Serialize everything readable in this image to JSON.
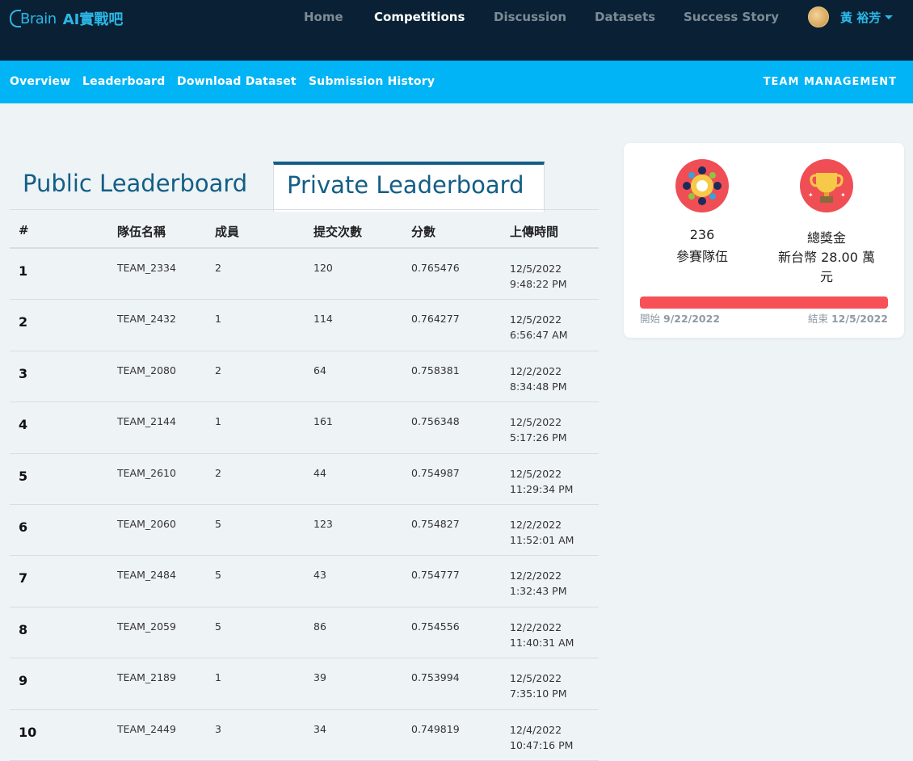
{
  "header": {
    "logo_text": "Brain",
    "logo_ai": "AI實戰吧",
    "nav": [
      {
        "label": "Home"
      },
      {
        "label": "Competitions"
      },
      {
        "label": "Discussion"
      },
      {
        "label": "Datasets"
      },
      {
        "label": "Success Story"
      }
    ],
    "user_name": "黃 裕芳"
  },
  "subnav": {
    "items": [
      {
        "label": "Overview"
      },
      {
        "label": "Leaderboard"
      },
      {
        "label": "Download Dataset"
      },
      {
        "label": "Submission History"
      }
    ],
    "team_management": "TEAM MANAGEMENT"
  },
  "tabs": {
    "public": "Public Leaderboard",
    "private": "Private Leaderboard"
  },
  "table": {
    "headers": [
      "#",
      "隊伍名稱",
      "成員",
      "提交次數",
      "分數",
      "上傳時間"
    ],
    "rows": [
      {
        "rank": "1",
        "team": "TEAM_2334",
        "members": "2",
        "submissions": "120",
        "score": "0.765476",
        "date": "12/5/2022",
        "time": "9:48:22 PM"
      },
      {
        "rank": "2",
        "team": "TEAM_2432",
        "members": "1",
        "submissions": "114",
        "score": "0.764277",
        "date": "12/5/2022",
        "time": "6:56:47 AM"
      },
      {
        "rank": "3",
        "team": "TEAM_2080",
        "members": "2",
        "submissions": "64",
        "score": "0.758381",
        "date": "12/2/2022",
        "time": "8:34:48 PM"
      },
      {
        "rank": "4",
        "team": "TEAM_2144",
        "members": "1",
        "submissions": "161",
        "score": "0.756348",
        "date": "12/5/2022",
        "time": "5:17:26 PM"
      },
      {
        "rank": "5",
        "team": "TEAM_2610",
        "members": "2",
        "submissions": "44",
        "score": "0.754987",
        "date": "12/5/2022",
        "time": "11:29:34 PM"
      },
      {
        "rank": "6",
        "team": "TEAM_2060",
        "members": "5",
        "submissions": "123",
        "score": "0.754827",
        "date": "12/2/2022",
        "time": "11:52:01 AM"
      },
      {
        "rank": "7",
        "team": "TEAM_2484",
        "members": "5",
        "submissions": "43",
        "score": "0.754777",
        "date": "12/2/2022",
        "time": "1:32:43 PM"
      },
      {
        "rank": "8",
        "team": "TEAM_2059",
        "members": "5",
        "submissions": "86",
        "score": "0.754556",
        "date": "12/2/2022",
        "time": "11:40:31 AM"
      },
      {
        "rank": "9",
        "team": "TEAM_2189",
        "members": "1",
        "submissions": "39",
        "score": "0.753994",
        "date": "12/5/2022",
        "time": "7:35:10 PM"
      },
      {
        "rank": "10",
        "team": "TEAM_2449",
        "members": "3",
        "submissions": "34",
        "score": "0.749819",
        "date": "12/4/2022",
        "time": "10:47:16 PM"
      }
    ]
  },
  "card": {
    "teams_count": "236",
    "teams_label": "參賽隊伍",
    "prize_title": "總獎金",
    "prize_value": "新台幣 28.00 萬",
    "prize_unit": "元",
    "progress_fraction": 1.0,
    "start_label": "開始",
    "start_date": "9/22/2022",
    "end_label": "結束",
    "end_date": "12/5/2022"
  },
  "colors": {
    "topbar": "#0a2135",
    "subbar": "#00b4f5",
    "accent": "#2bb7e6",
    "progress": "#f85057"
  }
}
